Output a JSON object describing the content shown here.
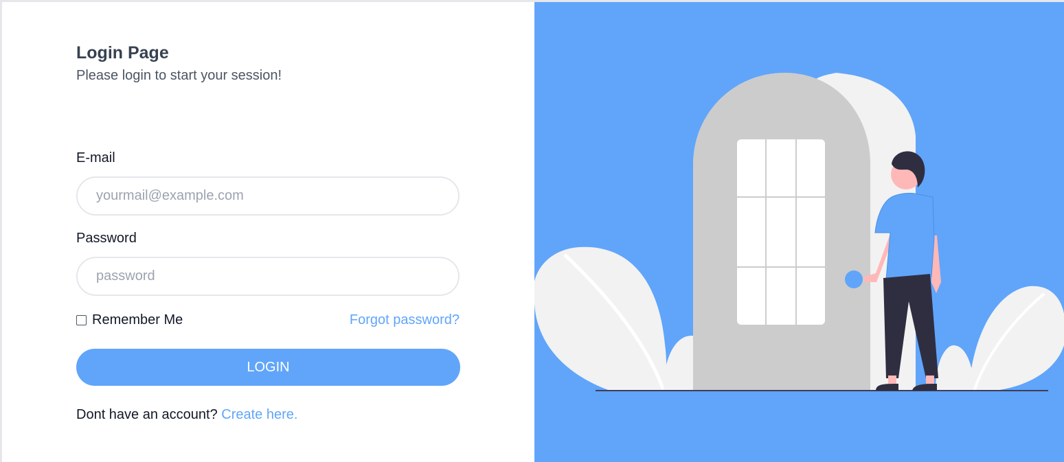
{
  "login": {
    "title": "Login Page",
    "subtitle": "Please login to start your session!",
    "email_label": "E-mail",
    "email_placeholder": "yourmail@example.com",
    "password_label": "Password",
    "password_placeholder": "password",
    "remember_label": "Remember Me",
    "remember_checked": false,
    "forgot_link": "Forgot password?",
    "login_button": "LOGIN",
    "signup_prompt": "Dont have an account?",
    "signup_link": "Create here."
  },
  "colors": {
    "accent": "#60a5fa",
    "title": "#374151",
    "subtitle": "#4b5563",
    "input_border": "#e5e7eb",
    "placeholder": "#9ca3af",
    "illustration_bg": "#60a5fa",
    "door": "#cccccc",
    "wall": "#f2f2f2",
    "person_pants": "#2f2e41",
    "person_skin": "#ffb8b8"
  },
  "illustration": {
    "icon": "door-person-illustration"
  }
}
